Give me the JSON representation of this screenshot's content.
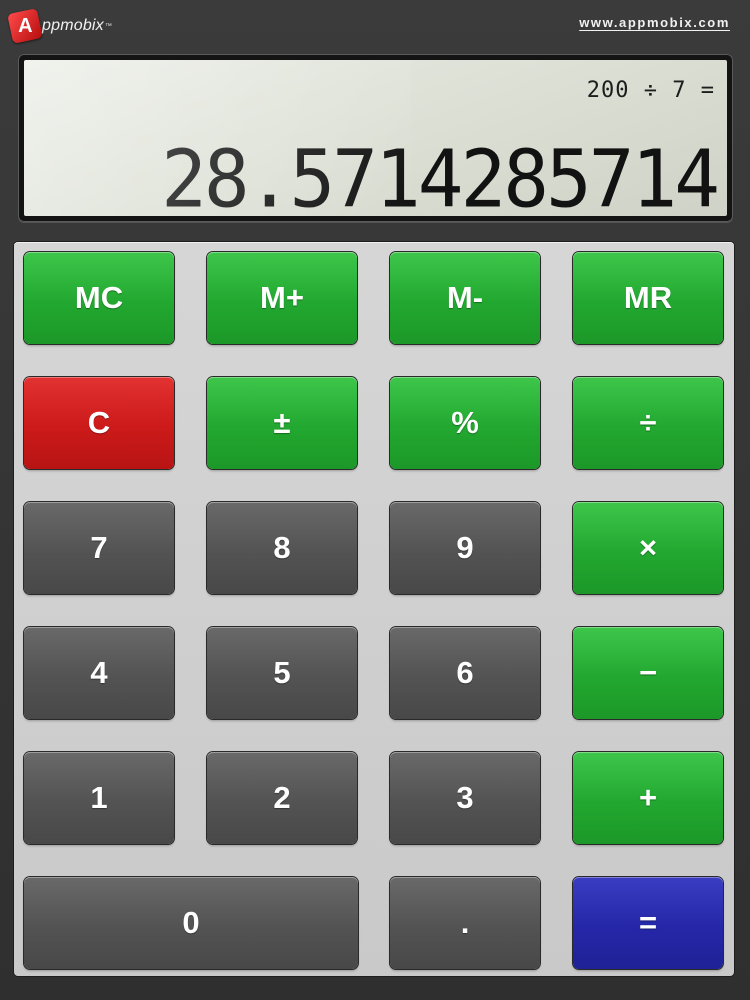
{
  "header": {
    "logo_letter": "A",
    "logo_text": "ppmobix",
    "logo_tm": "™",
    "site_url": "www.appmobix.com"
  },
  "display": {
    "expression": "200 ÷ 7 =",
    "result": "28.5714285714"
  },
  "keys": {
    "mc": "MC",
    "m_plus": "M+",
    "m_minus": "M-",
    "mr": "MR",
    "clear": "C",
    "plus_minus": "±",
    "percent": "%",
    "divide": "÷",
    "seven": "7",
    "eight": "8",
    "nine": "9",
    "multiply": "×",
    "four": "4",
    "five": "5",
    "six": "6",
    "subtract": "−",
    "one": "1",
    "two": "2",
    "three": "3",
    "add": "+",
    "zero": "0",
    "decimal": ".",
    "equals": "="
  },
  "colors": {
    "memory_operator_keys": "#22a830",
    "clear_key": "#cc1a1a",
    "digit_keys": "#535353",
    "equals_key": "#2527a8",
    "lcd_background": "#dde1d6"
  }
}
